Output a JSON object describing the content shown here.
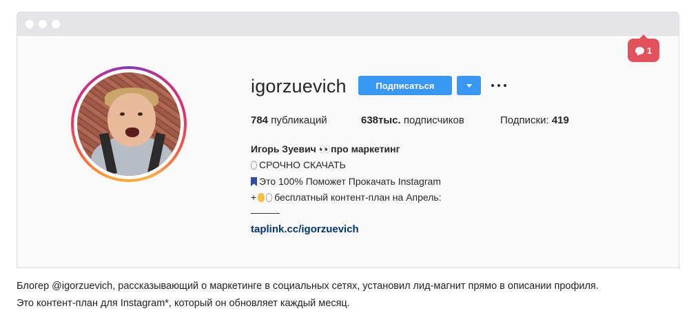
{
  "notification": {
    "count": "1",
    "icon": "comment-bubble-icon",
    "color": "#e2525c"
  },
  "profile": {
    "username": "igorzuevich",
    "follow_label": "Подписаться",
    "accent_color": "#3897f0",
    "stats": {
      "posts_value": "784",
      "posts_label": "публикаций",
      "followers_value": "638тыс.",
      "followers_label": "подписчиков",
      "following_label": "Подписки:",
      "following_value": "419"
    },
    "bio": {
      "name_line": "Игорь Зуевич 👀про маркетинг",
      "line1": "СРОЧНО СКАЧАТЬ",
      "line2": "Это 100% Поможет Прокачать Instagram",
      "line3_prefix": "+",
      "line3": "бесплатный контент-план на Апрель:",
      "line4": "———",
      "link": "taplink.cc/igorzuevich"
    }
  },
  "caption": {
    "line1": "Блогер @igorzuevich, рассказывающий о маркетинге в социальных сетях, установил лид-магнит прямо в описании профиля.",
    "line2": "Это контент-план для Instagram*, который он обновляет каждый месяц."
  }
}
